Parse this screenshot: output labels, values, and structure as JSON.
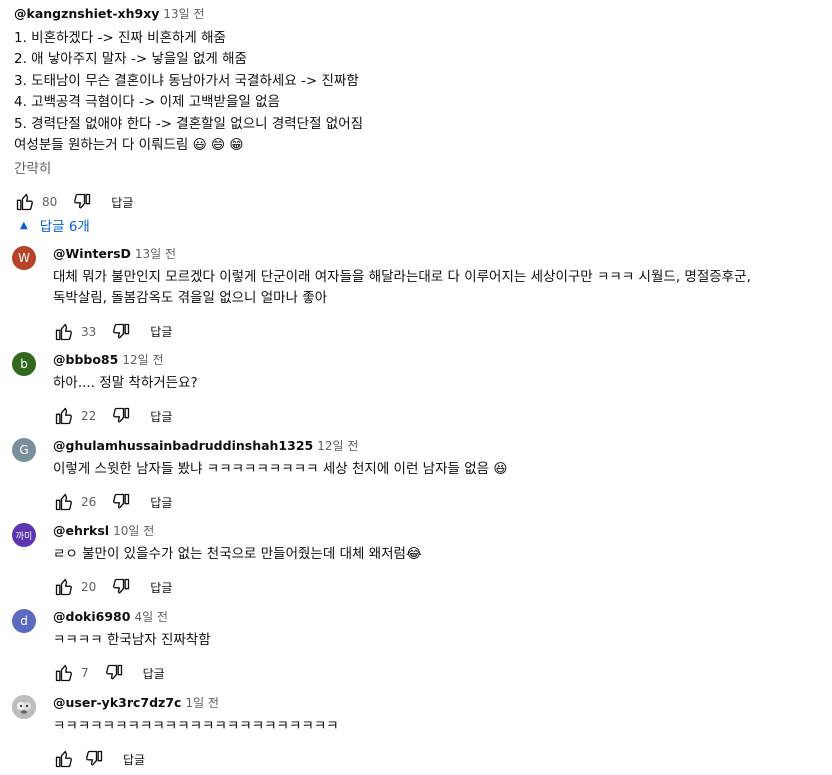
{
  "comment": {
    "handle": "@kangznshiet-xh9xy",
    "time": "13일 전",
    "lines": [
      "1. 비혼하겠다 -> 진짜 비혼하게 해줌",
      "2. 애 낳아주지 말자 -> 낳을일 없게 해줌",
      "3. 도태남이 무슨 결혼이냐 동남아가서 국결하세요 -> 진짜함",
      "4. 고백공격 극혐이다 -> 이제 고백받을일 없음",
      "5. 경력단절 없애야 한다 -> 결혼할일 없으니 경력단절 없어짐",
      "여성분들 원하는거 다 이뤄드림 😃 😄 😁"
    ],
    "collapse_label": "간략히",
    "likes": "80",
    "reply_label": "답글"
  },
  "replies_toggle": {
    "label": "답글 6개",
    "color": "#065fd4"
  },
  "replies": [
    {
      "avatar_text": "W",
      "avatar_color": "#b8432b",
      "handle": "@WintersD",
      "time": "13일 전",
      "lines": [
        "대체 뭐가 불만인지 모르겠다  이렇게  단군이래 여자들을 해달라는대로 다 이루어지는 세상이구만 ㅋㅋㅋ  시월드, 명절증후군,",
        "독박살림, 돌봄감옥도  겪을일 없으니 얼마나 좋아"
      ],
      "likes": "33",
      "reply_label": "답글"
    },
    {
      "avatar_text": "b",
      "avatar_color": "#33691e",
      "handle": "@bbbo85",
      "time": "12일 전",
      "lines": [
        "하아.... 정말 착하거든요?"
      ],
      "likes": "22",
      "reply_label": "답글"
    },
    {
      "avatar_text": "G",
      "avatar_color": "#78909c",
      "handle": "@ghulamhussainbadruddinshah1325",
      "time": "12일 전",
      "lines": [
        "이렇게 스윗한 남자들 봤냐 ㅋㅋㅋㅋㅋㅋㅋㅋㅋ 세상 천지에 이런 남자들 없음 😆"
      ],
      "likes": "26",
      "reply_label": "답글"
    },
    {
      "avatar_text": "까미",
      "avatar_color": "#5e35b1",
      "handle": "@ehrksl",
      "time": "10일 전",
      "lines": [
        "ㄹㅇ 불만이 있을수가 없는 천국으로 만들어줬는데 대체 왜저럼😂"
      ],
      "likes": "20",
      "reply_label": "답글"
    },
    {
      "avatar_text": "d",
      "avatar_color": "#5c6bc0",
      "handle": "@doki6980",
      "time": "4일 전",
      "lines": [
        "ㅋㅋㅋㅋ 한국남자 진짜착함"
      ],
      "likes": "7",
      "reply_label": "답글"
    },
    {
      "avatar_text": "",
      "avatar_color": "#9e9e9e",
      "handle": "@user-yk3rc7dz7c",
      "time": "1일 전",
      "lines": [
        "ㅋㅋㅋㅋㅋㅋㅋㅋㅋㅋㅋㅋㅋㅋㅋㅋㅋㅋㅋㅋㅋㅋㅋ"
      ],
      "likes": "",
      "reply_label": "답글"
    }
  ]
}
